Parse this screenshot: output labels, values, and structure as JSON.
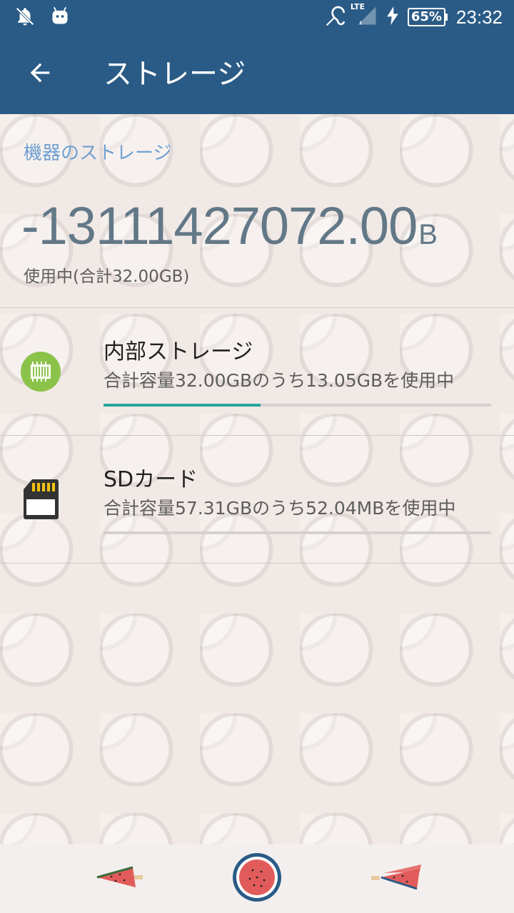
{
  "status_bar": {
    "time": "23:32",
    "battery": "65%",
    "network": "LTE",
    "icons": [
      "notifications-off-icon",
      "android-icon",
      "hearing-aid-icon",
      "signal-icon",
      "charging-icon",
      "battery-icon"
    ]
  },
  "app_bar": {
    "title": "ストレージ",
    "back_icon": "arrow-back-icon"
  },
  "device_storage": {
    "section_header": "機器のストレージ",
    "used_value": "-13111427072.00",
    "used_unit": "B",
    "used_caption": "使用中(合計32.00GB)"
  },
  "volumes": [
    {
      "title": "内部ストレージ",
      "summary": "合計容量32.00GBのうち13.05GBを使用中",
      "usage_fraction": 0.405,
      "icon": "internal-storage-chip-icon"
    },
    {
      "title": "SDカード",
      "summary": "合計容量57.31GBのうち52.04MBを使用中",
      "usage_fraction": 0.0,
      "icon": "sd-card-icon"
    }
  ],
  "nav_bar": {
    "items": [
      "back-nav-icon",
      "home-nav-icon",
      "recents-nav-icon"
    ]
  },
  "colors": {
    "app_bar": "#2a5b86",
    "accent": "#6f9fd0",
    "progress": "#26a69a",
    "background": "#f1e9e6"
  }
}
